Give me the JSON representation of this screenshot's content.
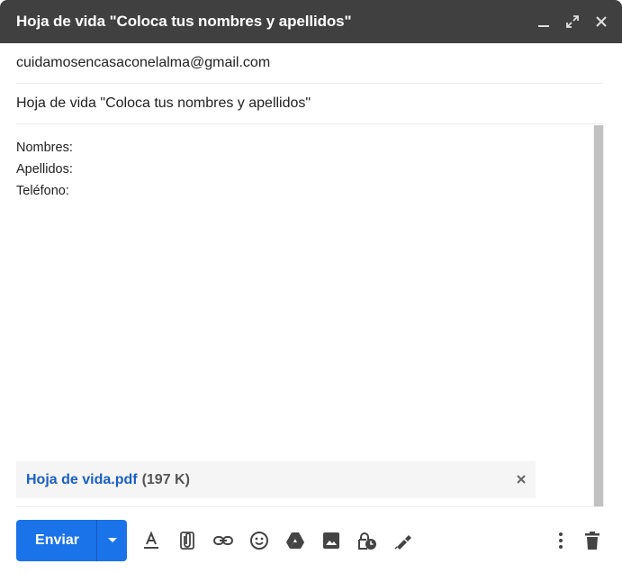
{
  "window": {
    "title": "Hoja de vida \"Coloca tus nombres y apellidos\""
  },
  "recipients": {
    "to": "cuidamosencasaconelalma@gmail.com"
  },
  "subject": "Hoja de vida \"Coloca tus nombres y apellidos\"",
  "body": {
    "lines": [
      "Nombres:",
      "Apellidos:",
      "Teléfono:"
    ]
  },
  "attachment": {
    "name": "Hoja de vida.pdf",
    "size": "(197 K)"
  },
  "toolbar": {
    "send_label": "Enviar",
    "icons": [
      "format-text-icon",
      "attach-file-icon",
      "insert-link-icon",
      "emoji-icon",
      "google-drive-icon",
      "insert-photo-icon",
      "confidential-mode-icon",
      "signature-icon",
      "more-options-icon",
      "delete-icon"
    ]
  },
  "colors": {
    "titlebar": "#404040",
    "send_button": "#1a73e8",
    "attachment_link": "#1a5fc4"
  }
}
